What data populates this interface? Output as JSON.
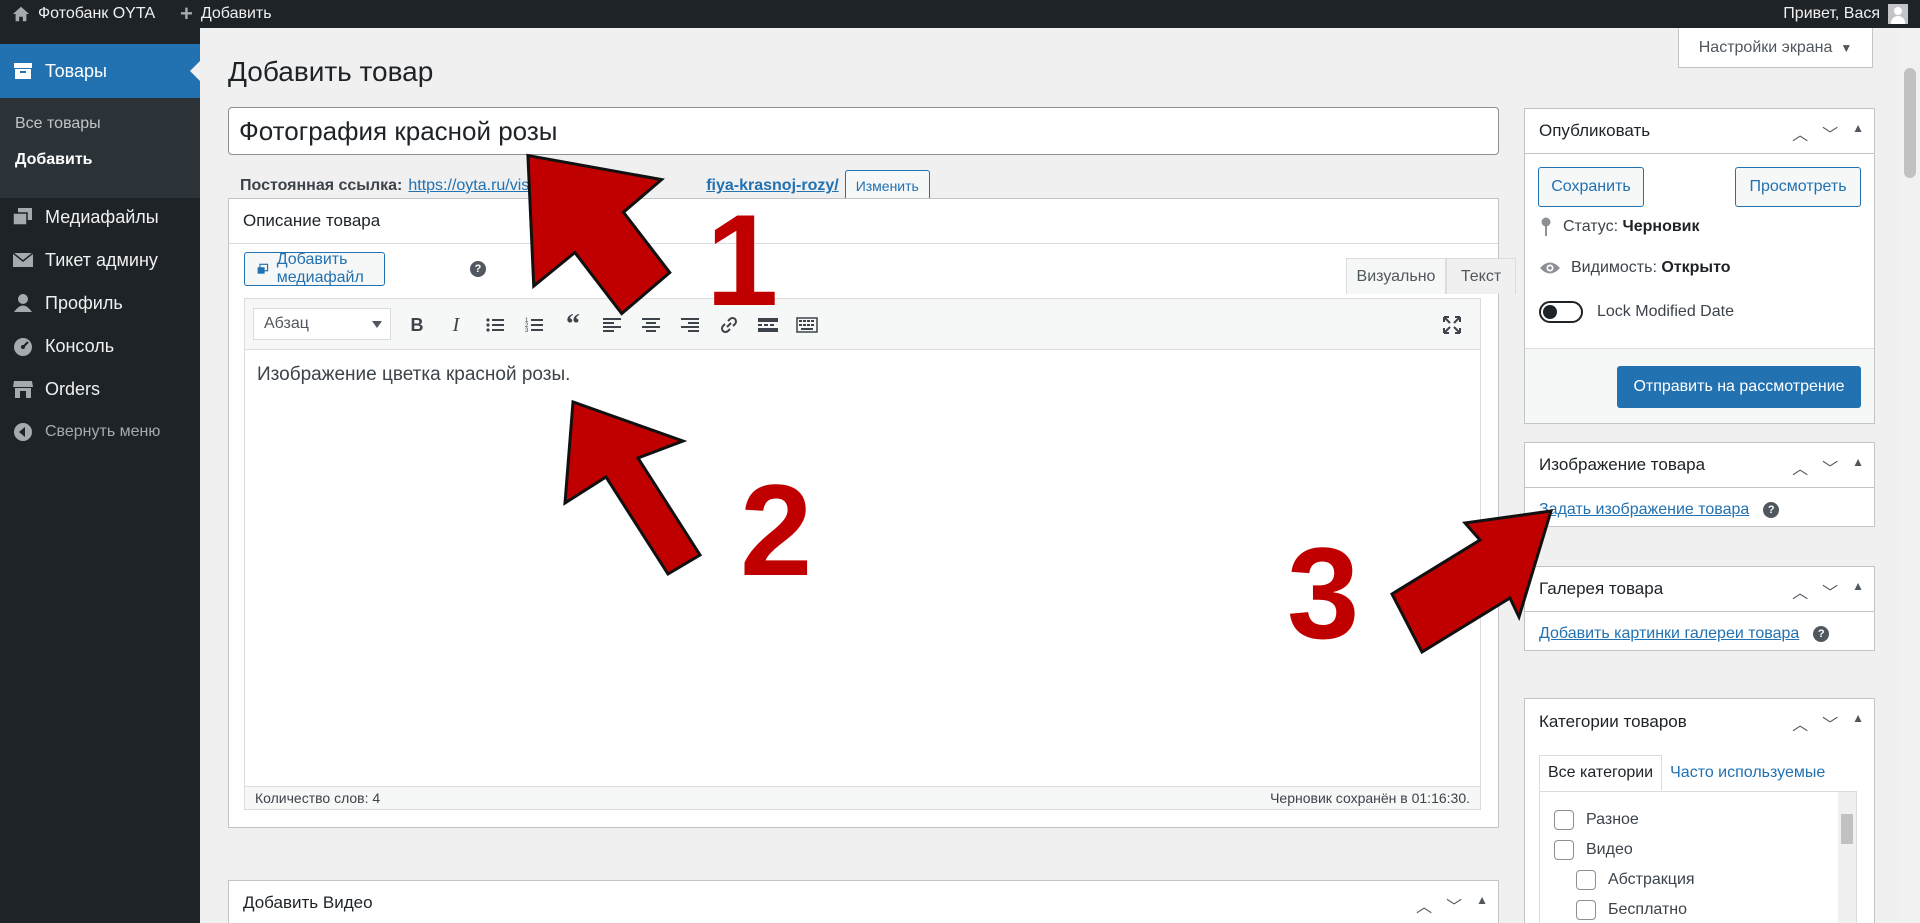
{
  "admin_bar": {
    "site_name": "Фотобанк OYTA",
    "new_label": "Добавить",
    "greeting": "Привет, Вася"
  },
  "sidebar": {
    "current": {
      "label": "Товары",
      "icon": "archive-icon"
    },
    "submenu": {
      "all": "Все товары",
      "add": "Добавить"
    },
    "items": [
      {
        "label": "Медиафайлы",
        "icon": "media-icon"
      },
      {
        "label": "Тикет админу",
        "icon": "mail-icon"
      },
      {
        "label": "Профиль",
        "icon": "user-icon"
      },
      {
        "label": "Консоль",
        "icon": "dashboard-icon"
      },
      {
        "label": "Orders",
        "icon": "store-icon"
      },
      {
        "label": "Свернуть меню",
        "icon": "collapse-icon"
      }
    ]
  },
  "screen_options": "Настройки экрана",
  "page_title": "Добавить товар",
  "title_value": "Фотография красной розы",
  "permalink": {
    "label": "Постоянная ссылка:",
    "url_start": "https://oyta.ru/visual-me",
    "url_end": "fiya-krasnoj-rozy/",
    "edit": "Изменить"
  },
  "editor": {
    "heading": "Описание товара",
    "add_media": "Добавить медиафайл",
    "tab_visual": "Визуально",
    "tab_text": "Текст",
    "format": "Абзац",
    "content": "Изображение цветка красной розы.",
    "word_count": "Количество слов: 4",
    "draft_saved": "Черновик сохранён в 01:16:30."
  },
  "video_box": {
    "heading": "Добавить Видео"
  },
  "publish": {
    "heading": "Опубликовать",
    "save": "Сохранить",
    "preview": "Просмотреть",
    "status_label": "Статус:",
    "status_value": "Черновик",
    "visibility_label": "Видимость:",
    "visibility_value": "Открыто",
    "lock_label": "Lock Modified Date",
    "submit": "Отправить на рассмотрение"
  },
  "product_image": {
    "heading": "Изображение товара",
    "link": "Задать изображение товара"
  },
  "gallery": {
    "heading": "Галерея товара",
    "link": "Добавить картинки галереи товара"
  },
  "categories": {
    "heading": "Категории товаров",
    "tab_all": "Все категории",
    "tab_popular": "Часто используемые",
    "items": [
      "Разное",
      "Видео",
      "Абстракция",
      "Бесплатно"
    ]
  },
  "annotations": [
    "1",
    "2",
    "3"
  ],
  "colors": {
    "accent": "#2271b1",
    "admin_dark": "#1d2327",
    "arrow": "#c00000"
  }
}
